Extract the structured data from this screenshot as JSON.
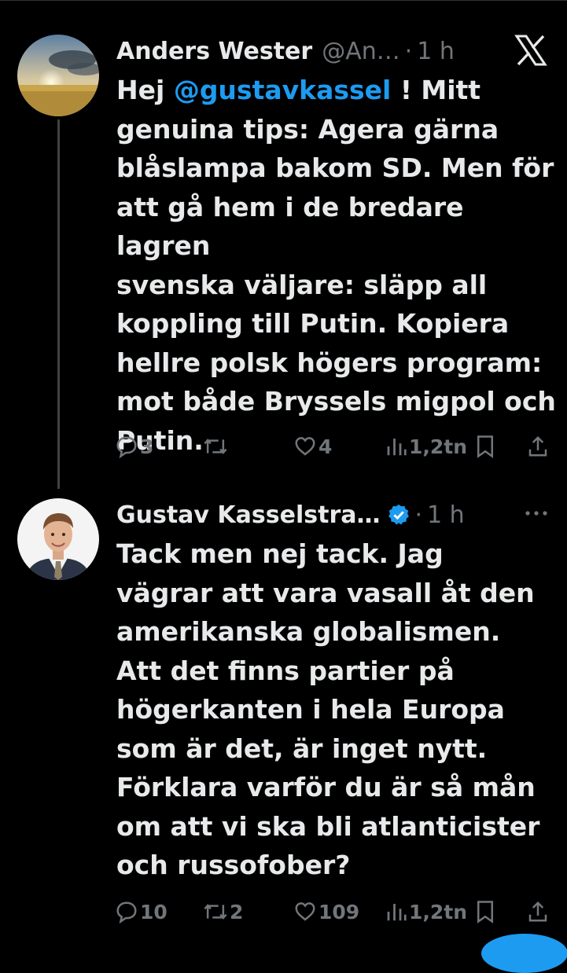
{
  "tweets": [
    {
      "author": "Anders Wester",
      "handle": "@An…",
      "separator": "·",
      "time": "1 h",
      "text_before_mention": "Hej ",
      "mention": "@gustavkassel",
      "text_after_mention": " ! Mitt\ngenuina tips: Agera gärna\nblåslampa bakom SD. Men för\natt gå hem i de bredare lagren\nsvenska väljare: släpp all\nkoppling till Putin. Kopiera\nhellre polsk högers program:\nmot både Bryssels migpol och\nPutin.",
      "replies": "3",
      "reposts": "",
      "likes": "4",
      "views": "1,2tn"
    },
    {
      "author": "Gustav Kasselstra…",
      "verified": true,
      "separator": "·",
      "time": "1 h",
      "text": "Tack men nej tack. Jag\nvägrar att vara vasall åt den\namerikanska globalismen.\nAtt det finns partier på\nhögerkanten i hela Europa\nsom är det, är inget nytt.\nFörklara varför du är så mån\nom att vi ska bli atlanticister\noch russofober?",
      "replies": "10",
      "reposts": "2",
      "likes": "109",
      "views": "1,2tn"
    }
  ],
  "colors": {
    "background": "#000000",
    "text": "#e7e9ea",
    "muted": "#71767b",
    "accent": "#1d9bf0"
  },
  "icons": [
    "x-logo-icon",
    "verified-badge-icon",
    "more-icon",
    "reply-icon",
    "repost-icon",
    "like-icon",
    "views-icon",
    "bookmark-icon",
    "share-icon"
  ]
}
